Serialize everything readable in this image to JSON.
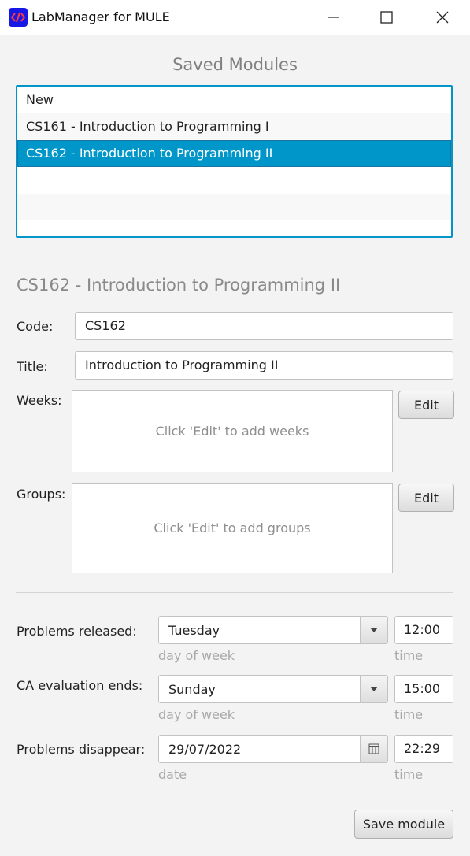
{
  "window": {
    "title": "LabManager for MULE",
    "minimize_icon": "minimize-icon",
    "maximize_icon": "maximize-icon",
    "close_icon": "close-icon"
  },
  "saved_modules": {
    "heading": "Saved Modules",
    "items": [
      {
        "label": "New",
        "selected": false
      },
      {
        "label": "CS161 - Introduction to Programming I",
        "selected": false
      },
      {
        "label": "CS162 - Introduction to Programming II",
        "selected": true
      }
    ],
    "accent_color": "#0096c9"
  },
  "module": {
    "heading": "CS162 - Introduction to Programming II",
    "code_label": "Code:",
    "code_value": "CS162",
    "title_label": "Title:",
    "title_value": "Introduction to Programming II",
    "weeks_label": "Weeks:",
    "weeks_placeholder": "Click 'Edit' to add weeks",
    "weeks_edit": "Edit",
    "groups_label": "Groups:",
    "groups_placeholder": "Click 'Edit' to add groups",
    "groups_edit": "Edit"
  },
  "schedule": {
    "released": {
      "label": "Problems released:",
      "day": "Tuesday",
      "day_hint": "day of week",
      "time": "12:00",
      "time_hint": "time"
    },
    "ca_ends": {
      "label": "CA evaluation ends:",
      "day": "Sunday",
      "day_hint": "day of week",
      "time": "15:00",
      "time_hint": "time"
    },
    "disappear": {
      "label": "Problems disappear:",
      "date": "29/07/2022",
      "date_hint": "date",
      "time": "22:29",
      "time_hint": "time"
    }
  },
  "save_button": "Save module"
}
